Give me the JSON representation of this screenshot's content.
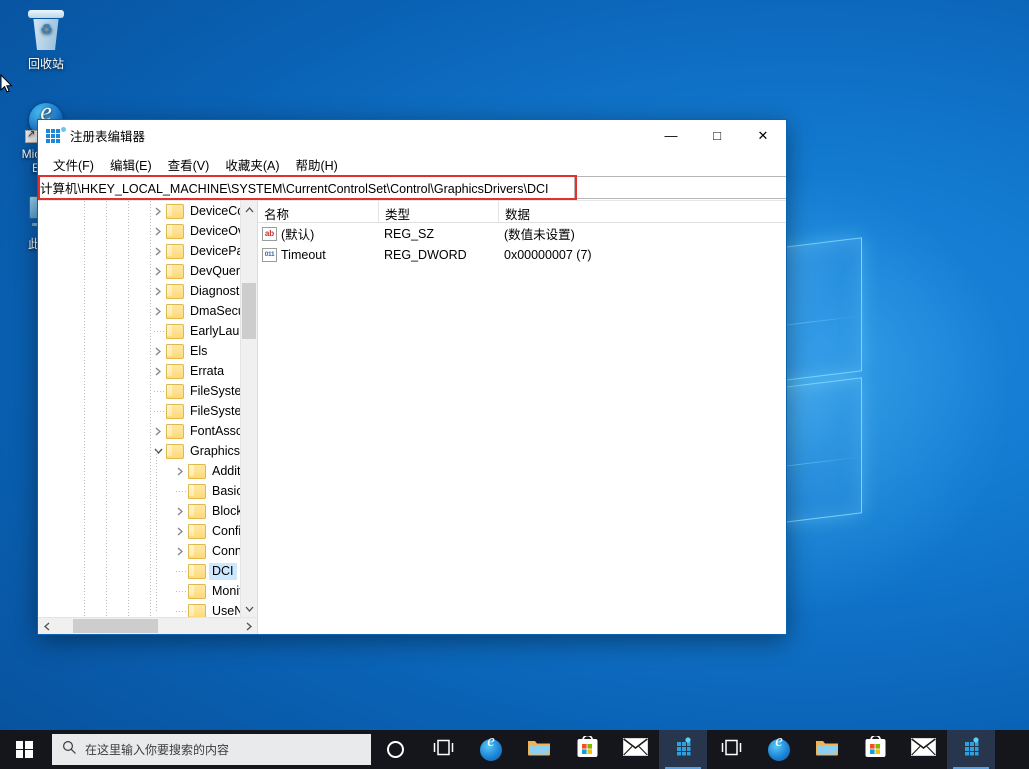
{
  "desktop": {
    "icons": [
      {
        "name": "recycle-bin",
        "label": "回收站"
      },
      {
        "name": "microsoft-edge",
        "label": "Microsoft Edge"
      },
      {
        "name": "this-pc",
        "label": "此电脑"
      }
    ]
  },
  "window": {
    "title": "注册表编辑器",
    "icon": "registry-editor-icon",
    "controls": {
      "minimize": "—",
      "maximize": "□",
      "close": "✕"
    },
    "menu": [
      {
        "name": "file",
        "label": "文件(F)"
      },
      {
        "name": "edit",
        "label": "编辑(E)"
      },
      {
        "name": "view",
        "label": "查看(V)"
      },
      {
        "name": "favorites",
        "label": "收藏夹(A)"
      },
      {
        "name": "help",
        "label": "帮助(H)"
      }
    ],
    "address": {
      "value": "计算机\\HKEY_LOCAL_MACHINE\\SYSTEM\\CurrentControlSet\\Control\\GraphicsDrivers\\DCI",
      "highlight_color": "#e03030"
    },
    "tree": [
      {
        "label": "DeviceContai",
        "indent": 0,
        "state": "collapsed",
        "selected": false
      },
      {
        "label": "DeviceOverri",
        "indent": 0,
        "state": "collapsed",
        "selected": false
      },
      {
        "label": "DevicePanels",
        "indent": 0,
        "state": "collapsed",
        "selected": false
      },
      {
        "label": "DevQuery",
        "indent": 0,
        "state": "collapsed",
        "selected": false
      },
      {
        "label": "Diagnostics",
        "indent": 0,
        "state": "collapsed",
        "selected": false
      },
      {
        "label": "DmaSecurity",
        "indent": 0,
        "state": "collapsed",
        "selected": false
      },
      {
        "label": "EarlyLaunch",
        "indent": 0,
        "state": "leaf",
        "selected": false
      },
      {
        "label": "Els",
        "indent": 0,
        "state": "collapsed",
        "selected": false
      },
      {
        "label": "Errata",
        "indent": 0,
        "state": "collapsed",
        "selected": false
      },
      {
        "label": "FileSystem",
        "indent": 0,
        "state": "leaf",
        "selected": false
      },
      {
        "label": "FileSystemUti",
        "indent": 0,
        "state": "leaf",
        "selected": false
      },
      {
        "label": "FontAssoc",
        "indent": 0,
        "state": "collapsed",
        "selected": false
      },
      {
        "label": "GraphicsDriv",
        "indent": 0,
        "state": "expanded",
        "selected": false
      },
      {
        "label": "Additional",
        "indent": 1,
        "state": "collapsed",
        "selected": false
      },
      {
        "label": "BasicDispl",
        "indent": 1,
        "state": "leaf",
        "selected": false
      },
      {
        "label": "BlockList",
        "indent": 1,
        "state": "collapsed",
        "selected": false
      },
      {
        "label": "Configurat",
        "indent": 1,
        "state": "collapsed",
        "selected": false
      },
      {
        "label": "Connectivi",
        "indent": 1,
        "state": "collapsed",
        "selected": false
      },
      {
        "label": "DCI",
        "indent": 1,
        "state": "leaf",
        "selected": true
      },
      {
        "label": "MonitorDa",
        "indent": 1,
        "state": "leaf",
        "selected": false
      },
      {
        "label": "UseNewKe",
        "indent": 1,
        "state": "leaf",
        "selected": false
      }
    ],
    "list": {
      "columns": [
        {
          "name": "name",
          "label": "名称"
        },
        {
          "name": "type",
          "label": "类型"
        },
        {
          "name": "data",
          "label": "数据"
        }
      ],
      "rows": [
        {
          "icon": "string-value-icon",
          "name": "(默认)",
          "type": "REG_SZ",
          "data": "(数值未设置)"
        },
        {
          "icon": "dword-value-icon",
          "name": "Timeout",
          "type": "REG_DWORD",
          "data": "0x00000007 (7)"
        }
      ]
    },
    "scrollbars": {
      "tree_up_arrow": "⌃",
      "tree_down_arrow": "⌄",
      "tree_left_arrow": "‹",
      "tree_right_arrow": "›"
    }
  },
  "taskbar": {
    "start": "start-button",
    "search": {
      "placeholder": "在这里输入你要搜索的内容",
      "icon": "search-icon"
    },
    "items": [
      {
        "name": "cortana-button",
        "icon": "cortana-circle-icon",
        "active": false
      },
      {
        "name": "task-view-button",
        "icon": "task-view-icon",
        "active": false
      },
      {
        "name": "edge-button",
        "icon": "edge-icon",
        "active": false
      },
      {
        "name": "file-explorer-button",
        "icon": "folder-icon",
        "active": false
      },
      {
        "name": "microsoft-store-button",
        "icon": "store-icon",
        "active": false
      },
      {
        "name": "mail-button",
        "icon": "mail-icon",
        "active": false
      },
      {
        "name": "registry-editor-button",
        "icon": "registry-editor-icon",
        "active": true
      },
      {
        "name": "task-view-button-2",
        "icon": "task-view-icon",
        "active": false
      },
      {
        "name": "edge-button-2",
        "icon": "edge-icon",
        "active": false
      },
      {
        "name": "file-explorer-button-2",
        "icon": "folder-icon",
        "active": false
      },
      {
        "name": "microsoft-store-button-2",
        "icon": "store-icon",
        "active": false
      },
      {
        "name": "mail-button-2",
        "icon": "mail-icon",
        "active": false
      },
      {
        "name": "registry-editor-button-2",
        "icon": "registry-editor-icon",
        "active": true
      }
    ]
  }
}
